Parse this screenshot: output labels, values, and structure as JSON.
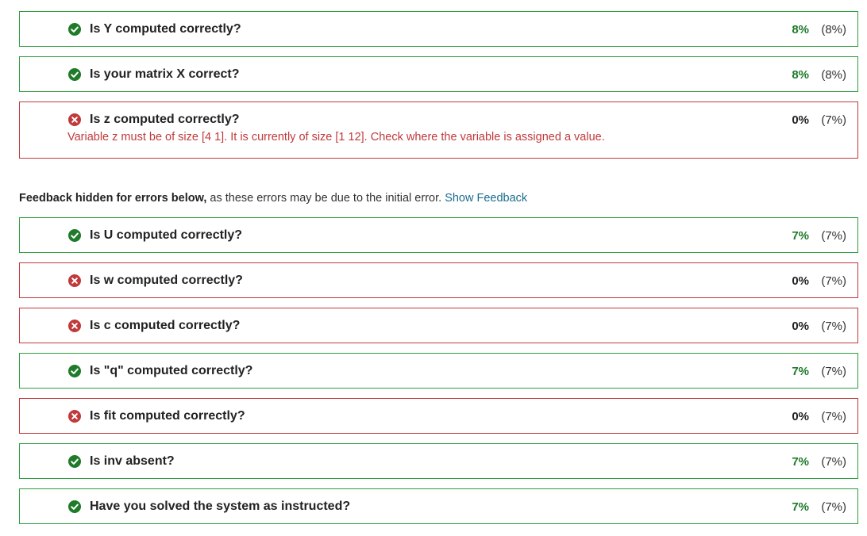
{
  "colors": {
    "pass": "#2e9e3e",
    "fail": "#c0393b",
    "link": "#1b6c8f"
  },
  "top_checks": [
    {
      "status": "pass",
      "icon": "check-circle-icon",
      "title": "Is Y computed correctly?",
      "score": "8%",
      "weight": "(8%)"
    },
    {
      "status": "pass",
      "icon": "check-circle-icon",
      "title": "Is your matrix X correct?",
      "score": "8%",
      "weight": "(8%)"
    },
    {
      "status": "fail",
      "icon": "x-circle-icon",
      "title": "Is z computed correctly?",
      "score": "0%",
      "weight": "(7%)",
      "message": "Variable z must be of size [4 1]. It is currently of size [1 12]. Check where the variable is assigned a value."
    }
  ],
  "notice": {
    "bold": "Feedback hidden for errors below,",
    "text": " as these errors may be due to the initial error. ",
    "link": "Show Feedback"
  },
  "hidden_checks": [
    {
      "status": "pass",
      "icon": "check-circle-icon",
      "title": "Is U computed correctly?",
      "score": "7%",
      "weight": "(7%)"
    },
    {
      "status": "fail",
      "icon": "x-circle-icon",
      "title": "Is w computed correctly?",
      "score": "0%",
      "weight": "(7%)"
    },
    {
      "status": "fail",
      "icon": "x-circle-icon",
      "title": "Is c computed correctly?",
      "score": "0%",
      "weight": "(7%)"
    },
    {
      "status": "pass",
      "icon": "check-circle-icon",
      "title": "Is \"q\" computed correctly?",
      "score": "7%",
      "weight": "(7%)"
    },
    {
      "status": "fail",
      "icon": "x-circle-icon",
      "title": "Is fit computed correctly?",
      "score": "0%",
      "weight": "(7%)"
    },
    {
      "status": "pass",
      "icon": "check-circle-icon",
      "title": "Is inv absent?",
      "score": "7%",
      "weight": "(7%)"
    },
    {
      "status": "pass",
      "icon": "check-circle-icon",
      "title": "Have you solved the system as instructed?",
      "score": "7%",
      "weight": "(7%)"
    }
  ]
}
